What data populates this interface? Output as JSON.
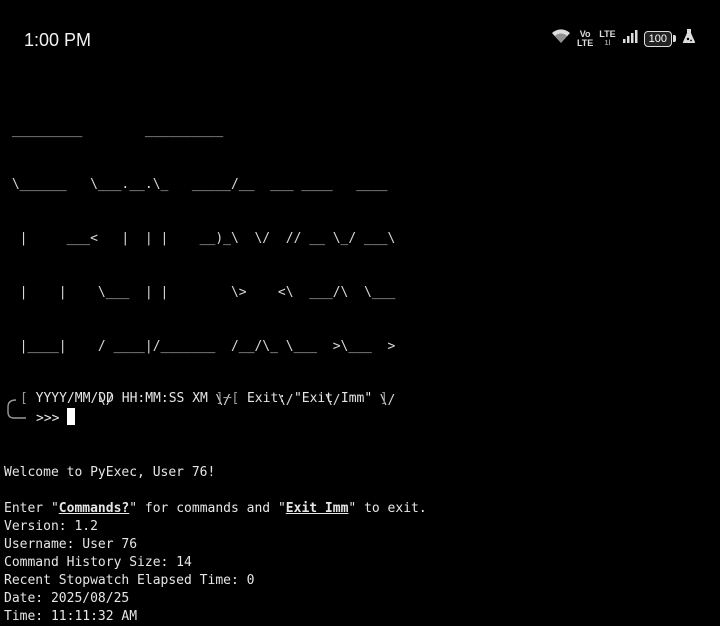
{
  "status_bar": {
    "time": "1:00 PM",
    "volte_top": "Vo",
    "volte_bottom": "LTE",
    "lte_top": "LTE",
    "lte_bottom": "1l",
    "battery": "100"
  },
  "terminal": {
    "banner": [
      " _________        __________                              ",
      " \\______   \\___.__.\\_   _____/__  ___ ____   ____  ",
      "  |     ___<   |  | |    __)_\\  \\/  // __ \\_/ ___\\ ",
      "  |    |    \\___  | |        \\>    <\\  ___/\\  \\___ ",
      "  |____|    / ____|/_______  /__/\\_ \\___  >\\___  >",
      "            \\/             \\/      \\/    \\/     \\/ "
    ],
    "welcome": "Welcome to PyExec, User 76!",
    "enter_prefix": "Enter \"",
    "commands_word": "Commands?",
    "enter_middle": "\" for commands and \"",
    "exit_word": "Exit Imm",
    "enter_suffix": "\" to exit.",
    "version": "Version: 1.2",
    "username": "Username: User 76",
    "history": "Command History Size: 14",
    "stopwatch": "Recent Stopwatch Elapsed Time: 0",
    "date": "Date: 2025/08/25",
    "time": "Time: 11:11:32 AM"
  },
  "prompt": {
    "bracket_open": "[",
    "datetime_format": " YYYY/MM/DD HH:MM:SS XM ",
    "bracket_close": "]",
    "separator": "─",
    "exit_hint": " Exit: \"Exit Imm\" ",
    "symbol": ">>> "
  }
}
